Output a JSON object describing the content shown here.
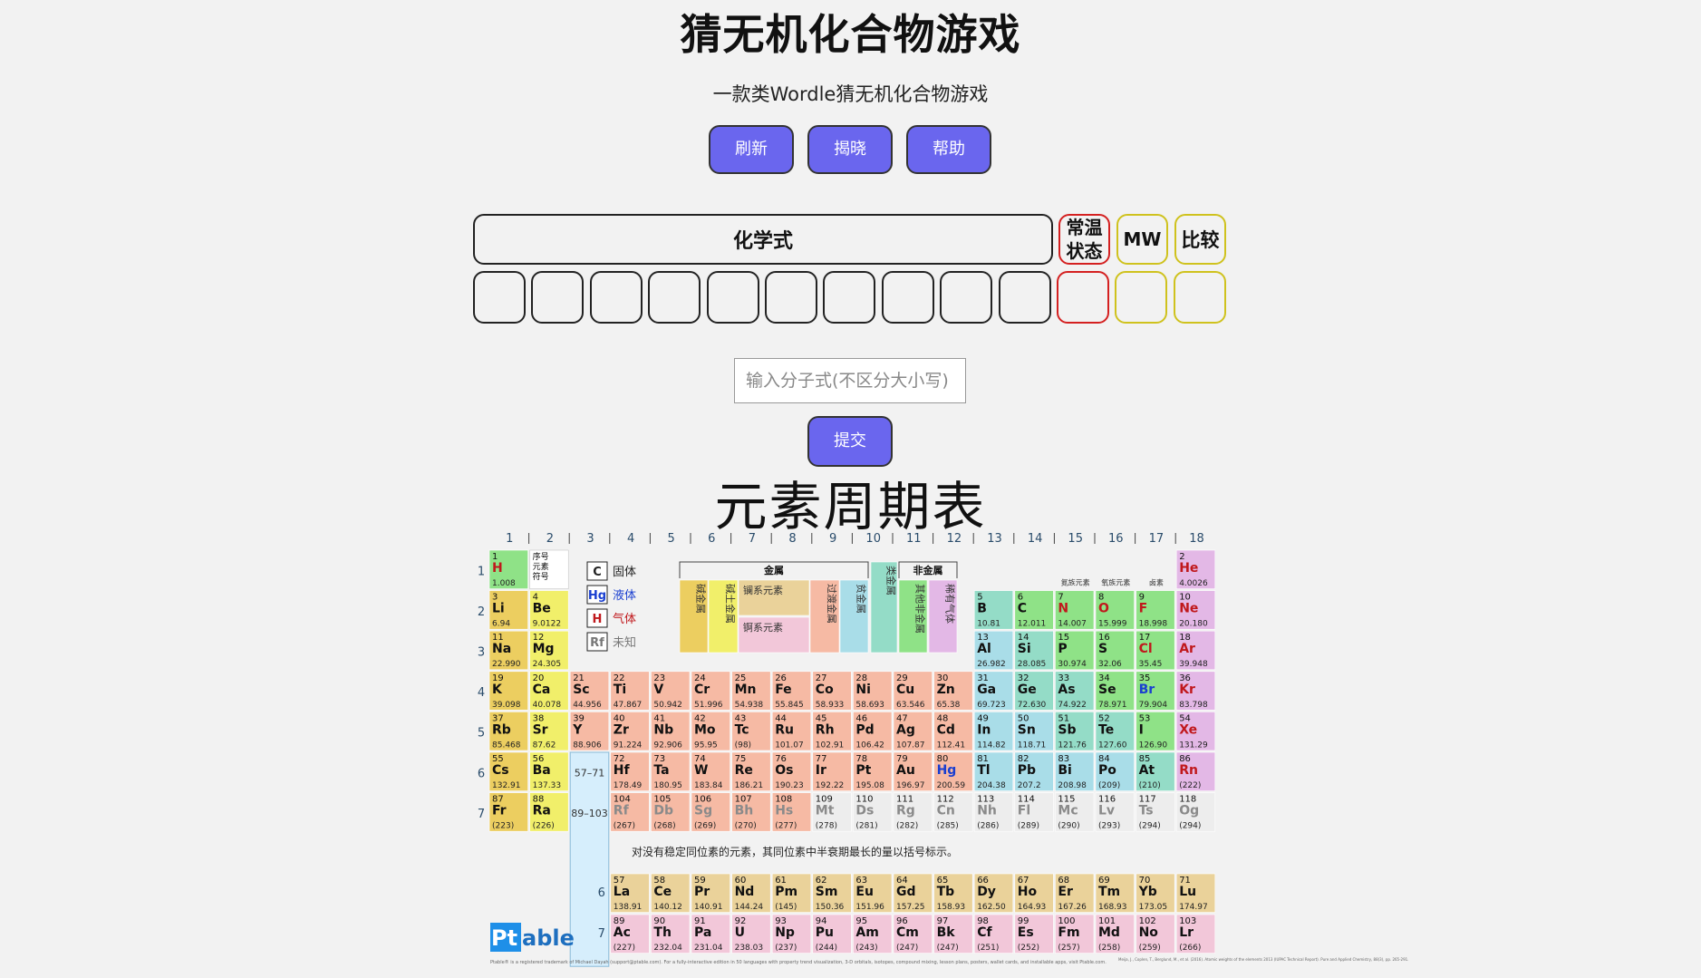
{
  "title": "猜无机化合物游戏",
  "subtitle": "一款类Wordle猜无机化合物游戏",
  "buttons": {
    "refresh": "刷新",
    "reveal": "揭晓",
    "help": "帮助",
    "submit": "提交"
  },
  "board": {
    "formula_label": "化学式",
    "state_label": "常温状态",
    "state_line1": "常温",
    "state_line2": "状态",
    "mw_label": "MW",
    "compare_label": "比较"
  },
  "input": {
    "placeholder": "输入分子式(不区分大小写)",
    "value": ""
  },
  "periodic_table": {
    "title": "元素周期表",
    "groups": [
      "1",
      "2",
      "3",
      "4",
      "5",
      "6",
      "7",
      "8",
      "9",
      "10",
      "11",
      "12",
      "13",
      "14",
      "15",
      "16",
      "17",
      "18"
    ],
    "periods": [
      "1",
      "2",
      "3",
      "4",
      "5",
      "6",
      "7"
    ],
    "legend": [
      {
        "symbol": "C",
        "label": "固体",
        "color": "#222222"
      },
      {
        "symbol": "Hg",
        "label": "液体",
        "color": "#1a3fd0"
      },
      {
        "symbol": "H",
        "label": "气体",
        "color": "#c0181c"
      },
      {
        "symbol": "Rf",
        "label": "未知",
        "color": "#777777"
      }
    ],
    "category_headers": {
      "metals": "金属",
      "nonmetals": "非金属"
    },
    "categories": [
      "碱金属",
      "碱土金属",
      "镧系元素",
      "锕系元素",
      "过渡金属",
      "贫金属",
      "类金属",
      "其他非金属",
      "稀有气体"
    ],
    "small_headers": [
      "氮族元素",
      "氧族元素",
      "卤素"
    ],
    "key_cell": [
      "序号",
      "元素",
      "符号"
    ],
    "lanthanide_ref": "57–71",
    "actinide_ref": "89–103",
    "f_period_labels": [
      "6",
      "7"
    ],
    "footnote": "对没有稳定同位素的元素，其同位素中半衰期最长的量以括号标示。",
    "brand_prefix": "Pt",
    "brand_suffix": "able",
    "fine_print": "Ptable® is a registered trademark of Michael Dayah (support@ptable.com). For a fully-interactive edition in 50 languages with property trend visualization, 3-D orbitals, isotopes, compound mixing, lesson plans, posters, wallet cards, and installable apps, visit Ptable.com.",
    "citation": "Meija, J., Coplen, T., Berglund, M., et al. (2016). Atomic weights of the elements 2013 (IUPAC Technical Report). Pure and Applied Chemistry, 88(3), pp. 265-291.",
    "colors": {
      "alkali": "#ecce60",
      "alkaline": "#f1ef6a",
      "lanthanide": "#ead29a",
      "actinide": "#f2c7d9",
      "transition": "#f6baa4",
      "poor": "#a9dde8",
      "metalloid": "#94dcc7",
      "nonmetal": "#8fe287",
      "noble": "#e3b8e6",
      "unknown": "#ededed"
    },
    "elements": [
      {
        "z": "1",
        "s": "H",
        "w": "1.008",
        "g": 1,
        "p": 1,
        "c": "nonmetal",
        "st": "gas"
      },
      {
        "z": "2",
        "s": "He",
        "w": "4.0026",
        "g": 18,
        "p": 1,
        "c": "noble",
        "st": "gas"
      },
      {
        "z": "3",
        "s": "Li",
        "w": "6.94",
        "g": 1,
        "p": 2,
        "c": "alkali",
        "st": "solid"
      },
      {
        "z": "4",
        "s": "Be",
        "w": "9.0122",
        "g": 2,
        "p": 2,
        "c": "alkaline",
        "st": "solid"
      },
      {
        "z": "5",
        "s": "B",
        "w": "10.81",
        "g": 13,
        "p": 2,
        "c": "metalloid",
        "st": "solid"
      },
      {
        "z": "6",
        "s": "C",
        "w": "12.011",
        "g": 14,
        "p": 2,
        "c": "nonmetal",
        "st": "solid"
      },
      {
        "z": "7",
        "s": "N",
        "w": "14.007",
        "g": 15,
        "p": 2,
        "c": "nonmetal",
        "st": "gas"
      },
      {
        "z": "8",
        "s": "O",
        "w": "15.999",
        "g": 16,
        "p": 2,
        "c": "nonmetal",
        "st": "gas"
      },
      {
        "z": "9",
        "s": "F",
        "w": "18.998",
        "g": 17,
        "p": 2,
        "c": "nonmetal",
        "st": "gas"
      },
      {
        "z": "10",
        "s": "Ne",
        "w": "20.180",
        "g": 18,
        "p": 2,
        "c": "noble",
        "st": "gas"
      },
      {
        "z": "11",
        "s": "Na",
        "w": "22.990",
        "g": 1,
        "p": 3,
        "c": "alkali",
        "st": "solid"
      },
      {
        "z": "12",
        "s": "Mg",
        "w": "24.305",
        "g": 2,
        "p": 3,
        "c": "alkaline",
        "st": "solid"
      },
      {
        "z": "13",
        "s": "Al",
        "w": "26.982",
        "g": 13,
        "p": 3,
        "c": "poor",
        "st": "solid"
      },
      {
        "z": "14",
        "s": "Si",
        "w": "28.085",
        "g": 14,
        "p": 3,
        "c": "metalloid",
        "st": "solid"
      },
      {
        "z": "15",
        "s": "P",
        "w": "30.974",
        "g": 15,
        "p": 3,
        "c": "nonmetal",
        "st": "solid"
      },
      {
        "z": "16",
        "s": "S",
        "w": "32.06",
        "g": 16,
        "p": 3,
        "c": "nonmetal",
        "st": "solid"
      },
      {
        "z": "17",
        "s": "Cl",
        "w": "35.45",
        "g": 17,
        "p": 3,
        "c": "nonmetal",
        "st": "gas"
      },
      {
        "z": "18",
        "s": "Ar",
        "w": "39.948",
        "g": 18,
        "p": 3,
        "c": "noble",
        "st": "gas"
      },
      {
        "z": "19",
        "s": "K",
        "w": "39.098",
        "g": 1,
        "p": 4,
        "c": "alkali",
        "st": "solid"
      },
      {
        "z": "20",
        "s": "Ca",
        "w": "40.078",
        "g": 2,
        "p": 4,
        "c": "alkaline",
        "st": "solid"
      },
      {
        "z": "21",
        "s": "Sc",
        "w": "44.956",
        "g": 3,
        "p": 4,
        "c": "transition",
        "st": "solid"
      },
      {
        "z": "22",
        "s": "Ti",
        "w": "47.867",
        "g": 4,
        "p": 4,
        "c": "transition",
        "st": "solid"
      },
      {
        "z": "23",
        "s": "V",
        "w": "50.942",
        "g": 5,
        "p": 4,
        "c": "transition",
        "st": "solid"
      },
      {
        "z": "24",
        "s": "Cr",
        "w": "51.996",
        "g": 6,
        "p": 4,
        "c": "transition",
        "st": "solid"
      },
      {
        "z": "25",
        "s": "Mn",
        "w": "54.938",
        "g": 7,
        "p": 4,
        "c": "transition",
        "st": "solid"
      },
      {
        "z": "26",
        "s": "Fe",
        "w": "55.845",
        "g": 8,
        "p": 4,
        "c": "transition",
        "st": "solid"
      },
      {
        "z": "27",
        "s": "Co",
        "w": "58.933",
        "g": 9,
        "p": 4,
        "c": "transition",
        "st": "solid"
      },
      {
        "z": "28",
        "s": "Ni",
        "w": "58.693",
        "g": 10,
        "p": 4,
        "c": "transition",
        "st": "solid"
      },
      {
        "z": "29",
        "s": "Cu",
        "w": "63.546",
        "g": 11,
        "p": 4,
        "c": "transition",
        "st": "solid"
      },
      {
        "z": "30",
        "s": "Zn",
        "w": "65.38",
        "g": 12,
        "p": 4,
        "c": "transition",
        "st": "solid"
      },
      {
        "z": "31",
        "s": "Ga",
        "w": "69.723",
        "g": 13,
        "p": 4,
        "c": "poor",
        "st": "solid"
      },
      {
        "z": "32",
        "s": "Ge",
        "w": "72.630",
        "g": 14,
        "p": 4,
        "c": "metalloid",
        "st": "solid"
      },
      {
        "z": "33",
        "s": "As",
        "w": "74.922",
        "g": 15,
        "p": 4,
        "c": "metalloid",
        "st": "solid"
      },
      {
        "z": "34",
        "s": "Se",
        "w": "78.971",
        "g": 16,
        "p": 4,
        "c": "nonmetal",
        "st": "solid"
      },
      {
        "z": "35",
        "s": "Br",
        "w": "79.904",
        "g": 17,
        "p": 4,
        "c": "nonmetal",
        "st": "liquid"
      },
      {
        "z": "36",
        "s": "Kr",
        "w": "83.798",
        "g": 18,
        "p": 4,
        "c": "noble",
        "st": "gas"
      },
      {
        "z": "37",
        "s": "Rb",
        "w": "85.468",
        "g": 1,
        "p": 5,
        "c": "alkali",
        "st": "solid"
      },
      {
        "z": "38",
        "s": "Sr",
        "w": "87.62",
        "g": 2,
        "p": 5,
        "c": "alkaline",
        "st": "solid"
      },
      {
        "z": "39",
        "s": "Y",
        "w": "88.906",
        "g": 3,
        "p": 5,
        "c": "transition",
        "st": "solid"
      },
      {
        "z": "40",
        "s": "Zr",
        "w": "91.224",
        "g": 4,
        "p": 5,
        "c": "transition",
        "st": "solid"
      },
      {
        "z": "41",
        "s": "Nb",
        "w": "92.906",
        "g": 5,
        "p": 5,
        "c": "transition",
        "st": "solid"
      },
      {
        "z": "42",
        "s": "Mo",
        "w": "95.95",
        "g": 6,
        "p": 5,
        "c": "transition",
        "st": "solid"
      },
      {
        "z": "43",
        "s": "Tc",
        "w": "(98)",
        "g": 7,
        "p": 5,
        "c": "transition",
        "st": "solid"
      },
      {
        "z": "44",
        "s": "Ru",
        "w": "101.07",
        "g": 8,
        "p": 5,
        "c": "transition",
        "st": "solid"
      },
      {
        "z": "45",
        "s": "Rh",
        "w": "102.91",
        "g": 9,
        "p": 5,
        "c": "transition",
        "st": "solid"
      },
      {
        "z": "46",
        "s": "Pd",
        "w": "106.42",
        "g": 10,
        "p": 5,
        "c": "transition",
        "st": "solid"
      },
      {
        "z": "47",
        "s": "Ag",
        "w": "107.87",
        "g": 11,
        "p": 5,
        "c": "transition",
        "st": "solid"
      },
      {
        "z": "48",
        "s": "Cd",
        "w": "112.41",
        "g": 12,
        "p": 5,
        "c": "transition",
        "st": "solid"
      },
      {
        "z": "49",
        "s": "In",
        "w": "114.82",
        "g": 13,
        "p": 5,
        "c": "poor",
        "st": "solid"
      },
      {
        "z": "50",
        "s": "Sn",
        "w": "118.71",
        "g": 14,
        "p": 5,
        "c": "poor",
        "st": "solid"
      },
      {
        "z": "51",
        "s": "Sb",
        "w": "121.76",
        "g": 15,
        "p": 5,
        "c": "metalloid",
        "st": "solid"
      },
      {
        "z": "52",
        "s": "Te",
        "w": "127.60",
        "g": 16,
        "p": 5,
        "c": "metalloid",
        "st": "solid"
      },
      {
        "z": "53",
        "s": "I",
        "w": "126.90",
        "g": 17,
        "p": 5,
        "c": "nonmetal",
        "st": "solid"
      },
      {
        "z": "54",
        "s": "Xe",
        "w": "131.29",
        "g": 18,
        "p": 5,
        "c": "noble",
        "st": "gas"
      },
      {
        "z": "55",
        "s": "Cs",
        "w": "132.91",
        "g": 1,
        "p": 6,
        "c": "alkali",
        "st": "solid"
      },
      {
        "z": "56",
        "s": "Ba",
        "w": "137.33",
        "g": 2,
        "p": 6,
        "c": "alkaline",
        "st": "solid"
      },
      {
        "z": "72",
        "s": "Hf",
        "w": "178.49",
        "g": 4,
        "p": 6,
        "c": "transition",
        "st": "solid"
      },
      {
        "z": "73",
        "s": "Ta",
        "w": "180.95",
        "g": 5,
        "p": 6,
        "c": "transition",
        "st": "solid"
      },
      {
        "z": "74",
        "s": "W",
        "w": "183.84",
        "g": 6,
        "p": 6,
        "c": "transition",
        "st": "solid"
      },
      {
        "z": "75",
        "s": "Re",
        "w": "186.21",
        "g": 7,
        "p": 6,
        "c": "transition",
        "st": "solid"
      },
      {
        "z": "76",
        "s": "Os",
        "w": "190.23",
        "g": 8,
        "p": 6,
        "c": "transition",
        "st": "solid"
      },
      {
        "z": "77",
        "s": "Ir",
        "w": "192.22",
        "g": 9,
        "p": 6,
        "c": "transition",
        "st": "solid"
      },
      {
        "z": "78",
        "s": "Pt",
        "w": "195.08",
        "g": 10,
        "p": 6,
        "c": "transition",
        "st": "solid"
      },
      {
        "z": "79",
        "s": "Au",
        "w": "196.97",
        "g": 11,
        "p": 6,
        "c": "transition",
        "st": "solid"
      },
      {
        "z": "80",
        "s": "Hg",
        "w": "200.59",
        "g": 12,
        "p": 6,
        "c": "transition",
        "st": "liquid"
      },
      {
        "z": "81",
        "s": "Tl",
        "w": "204.38",
        "g": 13,
        "p": 6,
        "c": "poor",
        "st": "solid"
      },
      {
        "z": "82",
        "s": "Pb",
        "w": "207.2",
        "g": 14,
        "p": 6,
        "c": "poor",
        "st": "solid"
      },
      {
        "z": "83",
        "s": "Bi",
        "w": "208.98",
        "g": 15,
        "p": 6,
        "c": "poor",
        "st": "solid"
      },
      {
        "z": "84",
        "s": "Po",
        "w": "(209)",
        "g": 16,
        "p": 6,
        "c": "poor",
        "st": "solid"
      },
      {
        "z": "85",
        "s": "At",
        "w": "(210)",
        "g": 17,
        "p": 6,
        "c": "metalloid",
        "st": "solid"
      },
      {
        "z": "86",
        "s": "Rn",
        "w": "(222)",
        "g": 18,
        "p": 6,
        "c": "noble",
        "st": "gas"
      },
      {
        "z": "87",
        "s": "Fr",
        "w": "(223)",
        "g": 1,
        "p": 7,
        "c": "alkali",
        "st": "solid"
      },
      {
        "z": "88",
        "s": "Ra",
        "w": "(226)",
        "g": 2,
        "p": 7,
        "c": "alkaline",
        "st": "solid"
      },
      {
        "z": "104",
        "s": "Rf",
        "w": "(267)",
        "g": 4,
        "p": 7,
        "c": "transition",
        "st": "unknown"
      },
      {
        "z": "105",
        "s": "Db",
        "w": "(268)",
        "g": 5,
        "p": 7,
        "c": "transition",
        "st": "unknown"
      },
      {
        "z": "106",
        "s": "Sg",
        "w": "(269)",
        "g": 6,
        "p": 7,
        "c": "transition",
        "st": "unknown"
      },
      {
        "z": "107",
        "s": "Bh",
        "w": "(270)",
        "g": 7,
        "p": 7,
        "c": "transition",
        "st": "unknown"
      },
      {
        "z": "108",
        "s": "Hs",
        "w": "(277)",
        "g": 8,
        "p": 7,
        "c": "transition",
        "st": "unknown"
      },
      {
        "z": "109",
        "s": "Mt",
        "w": "(278)",
        "g": 9,
        "p": 7,
        "c": "unknown",
        "st": "unknown"
      },
      {
        "z": "110",
        "s": "Ds",
        "w": "(281)",
        "g": 10,
        "p": 7,
        "c": "unknown",
        "st": "unknown"
      },
      {
        "z": "111",
        "s": "Rg",
        "w": "(282)",
        "g": 11,
        "p": 7,
        "c": "unknown",
        "st": "unknown"
      },
      {
        "z": "112",
        "s": "Cn",
        "w": "(285)",
        "g": 12,
        "p": 7,
        "c": "unknown",
        "st": "unknown"
      },
      {
        "z": "113",
        "s": "Nh",
        "w": "(286)",
        "g": 13,
        "p": 7,
        "c": "unknown",
        "st": "unknown"
      },
      {
        "z": "114",
        "s": "Fl",
        "w": "(289)",
        "g": 14,
        "p": 7,
        "c": "unknown",
        "st": "unknown"
      },
      {
        "z": "115",
        "s": "Mc",
        "w": "(290)",
        "g": 15,
        "p": 7,
        "c": "unknown",
        "st": "unknown"
      },
      {
        "z": "116",
        "s": "Lv",
        "w": "(293)",
        "g": 16,
        "p": 7,
        "c": "unknown",
        "st": "unknown"
      },
      {
        "z": "117",
        "s": "Ts",
        "w": "(294)",
        "g": 17,
        "p": 7,
        "c": "unknown",
        "st": "unknown"
      },
      {
        "z": "118",
        "s": "Og",
        "w": "(294)",
        "g": 18,
        "p": 7,
        "c": "unknown",
        "st": "unknown"
      }
    ],
    "lanthanides": [
      {
        "z": "57",
        "s": "La",
        "w": "138.91"
      },
      {
        "z": "58",
        "s": "Ce",
        "w": "140.12"
      },
      {
        "z": "59",
        "s": "Pr",
        "w": "140.91"
      },
      {
        "z": "60",
        "s": "Nd",
        "w": "144.24"
      },
      {
        "z": "61",
        "s": "Pm",
        "w": "(145)"
      },
      {
        "z": "62",
        "s": "Sm",
        "w": "150.36"
      },
      {
        "z": "63",
        "s": "Eu",
        "w": "151.96"
      },
      {
        "z": "64",
        "s": "Gd",
        "w": "157.25"
      },
      {
        "z": "65",
        "s": "Tb",
        "w": "158.93"
      },
      {
        "z": "66",
        "s": "Dy",
        "w": "162.50"
      },
      {
        "z": "67",
        "s": "Ho",
        "w": "164.93"
      },
      {
        "z": "68",
        "s": "Er",
        "w": "167.26"
      },
      {
        "z": "69",
        "s": "Tm",
        "w": "168.93"
      },
      {
        "z": "70",
        "s": "Yb",
        "w": "173.05"
      },
      {
        "z": "71",
        "s": "Lu",
        "w": "174.97"
      }
    ],
    "actinides": [
      {
        "z": "89",
        "s": "Ac",
        "w": "(227)"
      },
      {
        "z": "90",
        "s": "Th",
        "w": "232.04"
      },
      {
        "z": "91",
        "s": "Pa",
        "w": "231.04"
      },
      {
        "z": "92",
        "s": "U",
        "w": "238.03"
      },
      {
        "z": "93",
        "s": "Np",
        "w": "(237)"
      },
      {
        "z": "94",
        "s": "Pu",
        "w": "(244)"
      },
      {
        "z": "95",
        "s": "Am",
        "w": "(243)"
      },
      {
        "z": "96",
        "s": "Cm",
        "w": "(247)"
      },
      {
        "z": "97",
        "s": "Bk",
        "w": "(247)"
      },
      {
        "z": "98",
        "s": "Cf",
        "w": "(251)"
      },
      {
        "z": "99",
        "s": "Es",
        "w": "(252)"
      },
      {
        "z": "100",
        "s": "Fm",
        "w": "(257)"
      },
      {
        "z": "101",
        "s": "Md",
        "w": "(258)"
      },
      {
        "z": "102",
        "s": "No",
        "w": "(259)"
      },
      {
        "z": "103",
        "s": "Lr",
        "w": "(266)"
      }
    ],
    "state_colors": {
      "solid": "#111111",
      "liquid": "#1a3fd0",
      "gas": "#c0181c",
      "unknown": "#8a8a8a"
    }
  }
}
